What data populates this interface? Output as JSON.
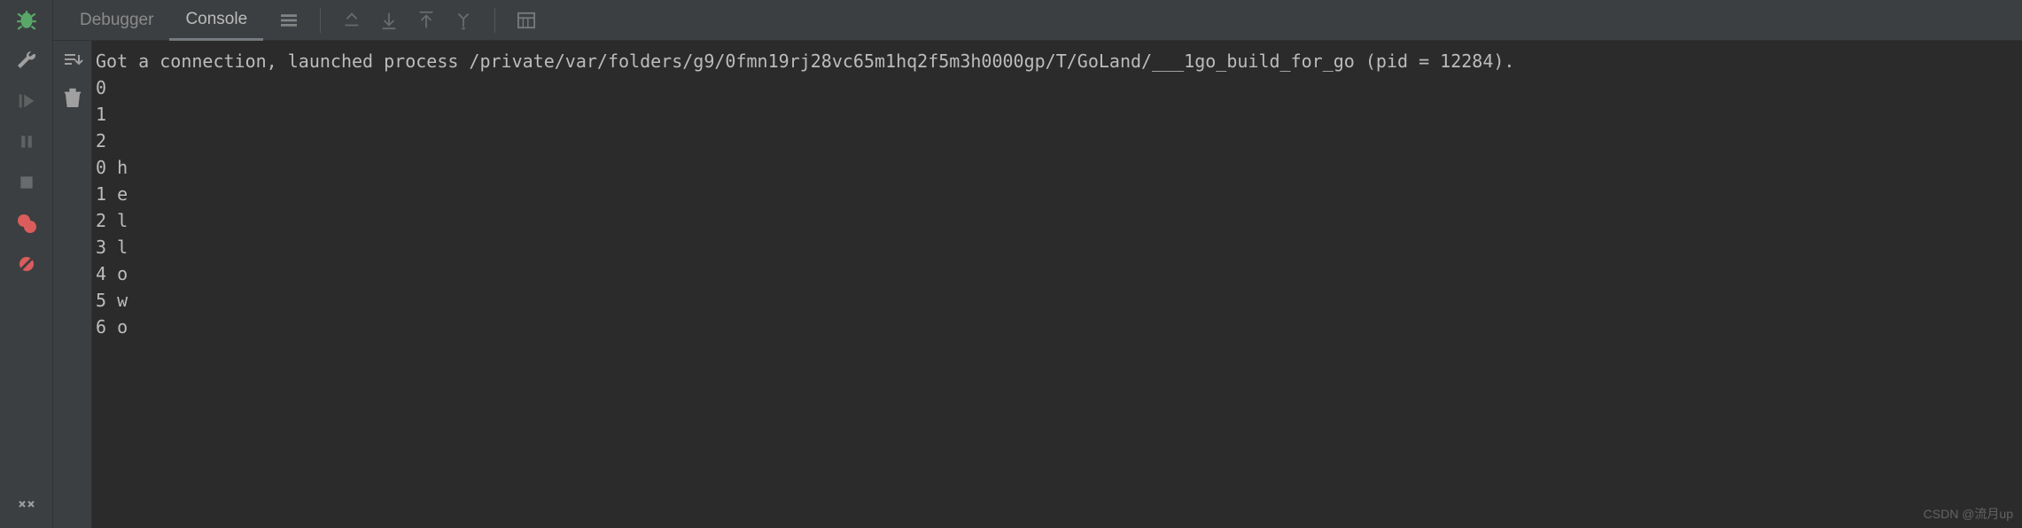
{
  "tabs": {
    "debugger": "Debugger",
    "console": "Console"
  },
  "left_gutter_icons": [
    "bug",
    "wrench",
    "resume",
    "pause",
    "stop",
    "breakpoints",
    "mute-breakpoints",
    "more"
  ],
  "toolbar_icons": [
    "settings",
    "step-out",
    "step-down",
    "step-up",
    "run-to-cursor",
    "evaluate"
  ],
  "toolstrip_icons": [
    "scroll-to-end",
    "clear-all"
  ],
  "console_output": [
    "Got a connection, launched process /private/var/folders/g9/0fmn19rj28vc65m1hq2f5m3h0000gp/T/GoLand/___1go_build_for_go (pid = 12284).",
    "0",
    "1",
    "2",
    "0 h",
    "1 e",
    "2 l",
    "3 l",
    "4 o",
    "5 w",
    "6 o"
  ],
  "watermark": "CSDN @流月up"
}
